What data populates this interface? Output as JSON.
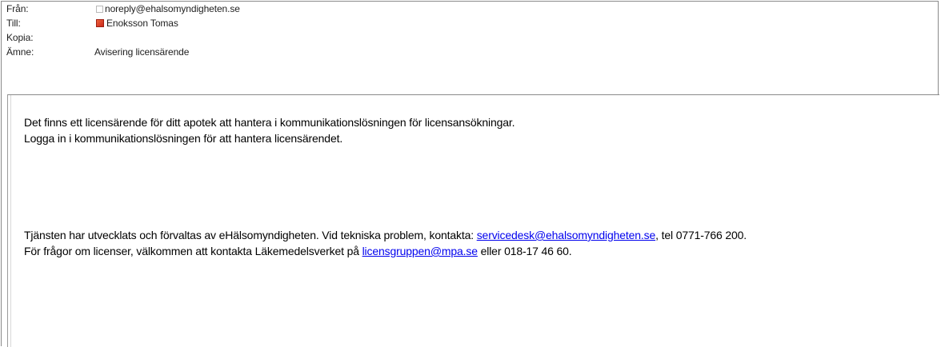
{
  "header": {
    "from_label": "Från:",
    "from_value": "noreply@ehalsomyndigheten.se",
    "to_label": "Till:",
    "to_value": "Enoksson Tomas",
    "cc_label": "Kopia:",
    "subject_label": "Ämne:",
    "subject_value": "Avisering licensärende"
  },
  "body": {
    "line1": "Det finns ett licensärende för ditt apotek att hantera i kommunikationslösningen för licensansökningar.",
    "line2": "Logga in i kommunikationslösningen för att hantera licensärendet.",
    "line3_before": "Tjänsten har utvecklats och förvaltas av eHälsomyndigheten. Vid tekniska problem, kontakta: ",
    "line3_link": "servicedesk@ehalsomyndigheten.se",
    "line3_after": ", tel 0771-766 200.",
    "line4_before": "För frågor om licenser, välkommen att kontakta Läkemedelsverket på ",
    "line4_link": "licensgruppen@mpa.se",
    "line4_after": " eller 018-17 46 60."
  },
  "icons": {
    "from_status": "contact-status-offline-icon",
    "to_status": "contact-status-busy-icon"
  },
  "colors": {
    "link": "#0000ee",
    "busy_status": "#d8321f"
  }
}
